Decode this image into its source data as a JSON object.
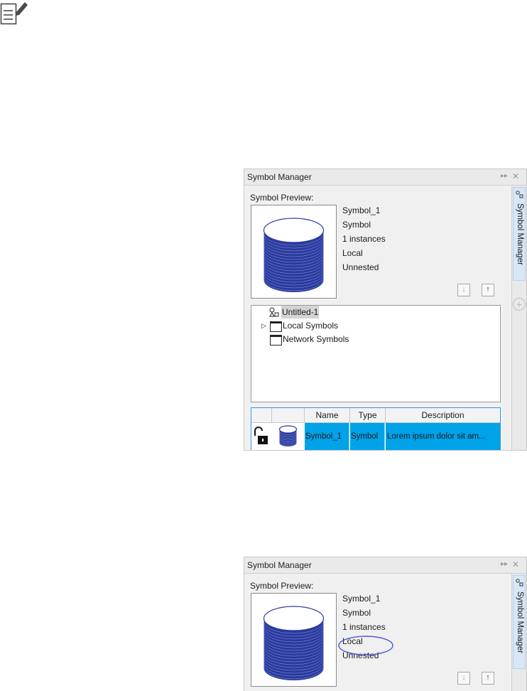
{
  "note_icon": "note-edit-icon",
  "panels": [
    {
      "title": "Symbol Manager",
      "side_tab_label": "Symbol Manager",
      "preview_label": "Symbol Preview:",
      "info": {
        "name": "Symbol_1",
        "type": "Symbol",
        "instances": "1 instances",
        "scope": "Local",
        "nesting": "Unnested"
      },
      "tree": {
        "root": "Untitled-1",
        "items": [
          "Local Symbols",
          "Network Symbols"
        ]
      },
      "table": {
        "headers": [
          "",
          "",
          "Name",
          "Type",
          "Description"
        ],
        "rows": [
          {
            "name": "Symbol_1",
            "type": "Symbol",
            "description": "Lorem ipsum dolor sit am..."
          }
        ]
      }
    },
    {
      "title": "Symbol Manager",
      "side_tab_label": "Symbol Manager",
      "preview_label": "Symbol Preview:",
      "info": {
        "name": "Symbol_1",
        "type": "Symbol",
        "instances": "1 instances",
        "scope": "Local",
        "nesting": "Unnested"
      }
    }
  ],
  "colors": {
    "cylinder": "#2a3a9e",
    "selection": "#00a2e8",
    "highlight_ellipse": "#4a5ad0"
  }
}
